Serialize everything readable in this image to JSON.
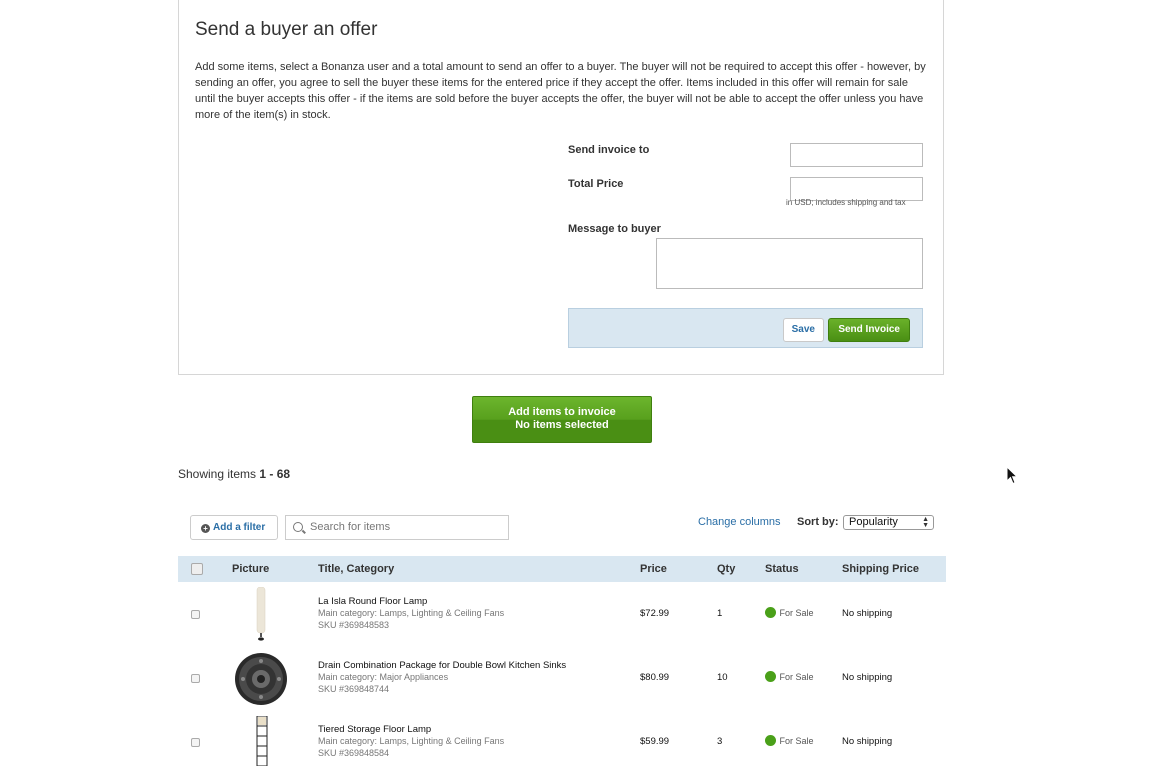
{
  "offer": {
    "title": "Send a buyer an offer",
    "description": "Add some items, select a Bonanza user and a total amount to send an offer to a buyer. The buyer will not be required to accept this offer - however, by sending an offer, you agree to sell the buyer these items for the entered price if they accept the offer. Items included in this offer will remain for sale until the buyer accepts this offer - if the items are sold before the buyer accepts the offer, the buyer will not be able to accept the offer unless you have more of the item(s) in stock.",
    "send_invoice_label": "Send invoice to",
    "send_invoice_value": "",
    "total_price_label": "Total Price",
    "total_price_value": "",
    "total_price_hint": "in USD; includes shipping and tax",
    "message_label": "Message to buyer",
    "message_value": "",
    "save_label": "Save",
    "send_label": "Send Invoice"
  },
  "add_items": {
    "line1": "Add items to invoice",
    "line2": "No items selected"
  },
  "listing": {
    "showing_prefix": "Showing items ",
    "showing_range": "1 - 68",
    "add_filter_label": "Add a filter",
    "search_placeholder": "Search for items",
    "change_columns_label": "Change columns",
    "sort_label": "Sort by:",
    "sort_value": "Popularity"
  },
  "table": {
    "headers": {
      "picture": "Picture",
      "title": "Title, Category",
      "price": "Price",
      "qty": "Qty",
      "status": "Status",
      "shipping": "Shipping Price"
    },
    "rows": [
      {
        "title": "La Isla Round Floor Lamp",
        "category": "Main category: Lamps, Lighting & Ceiling Fans",
        "sku": "SKU #369848583",
        "price": "$72.99",
        "qty": "1",
        "status": "For Sale",
        "shipping": "No shipping"
      },
      {
        "title": "Drain Combination Package for Double Bowl Kitchen Sinks",
        "category": "Main category: Major Appliances",
        "sku": "SKU #369848744",
        "price": "$80.99",
        "qty": "10",
        "status": "For Sale",
        "shipping": "No shipping"
      },
      {
        "title": "Tiered Storage Floor Lamp",
        "category": "Main category: Lamps, Lighting & Ceiling Fans",
        "sku": "SKU #369848584",
        "price": "$59.99",
        "qty": "3",
        "status": "For Sale",
        "shipping": "No shipping"
      }
    ]
  },
  "colors": {
    "accent_green": "#4a8f14",
    "link_blue": "#2a6ea6",
    "table_header_bg": "#d9e7f1",
    "status_green": "#4aa019"
  },
  "icons": [
    "plus-circle-icon",
    "search-icon",
    "select-arrows-icon",
    "mouse-cursor-icon"
  ]
}
